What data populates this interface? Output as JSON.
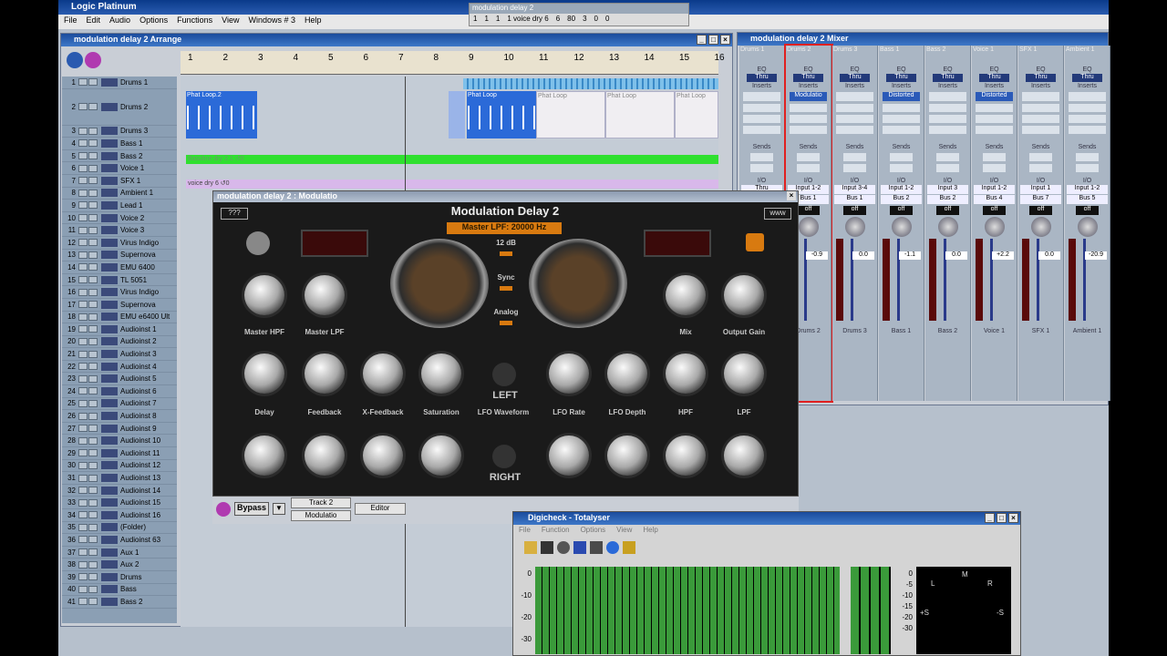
{
  "app": {
    "title": "Logic Platinum"
  },
  "menu": [
    "File",
    "Edit",
    "Audio",
    "Options",
    "Functions",
    "View",
    "Windows # 3",
    "Help"
  ],
  "transport": {
    "title": "modulation delay 2",
    "values": [
      "1",
      "1",
      "1",
      "1 voice dry 6",
      "6",
      "80",
      "3",
      "0",
      "0"
    ]
  },
  "arrange": {
    "title": "modulation delay 2 Arrange",
    "ruler": [
      "1",
      "2",
      "3",
      "4",
      "5",
      "6",
      "7",
      "8",
      "9",
      "10",
      "11",
      "12",
      "13",
      "14",
      "15",
      "16"
    ],
    "tracks": [
      {
        "n": "1",
        "name": "Drums 1"
      },
      {
        "n": "2",
        "name": "Drums 2"
      },
      {
        "n": "3",
        "name": "Drums 3"
      },
      {
        "n": "4",
        "name": "Bass 1"
      },
      {
        "n": "5",
        "name": "Bass 2"
      },
      {
        "n": "6",
        "name": "Voice 1"
      },
      {
        "n": "7",
        "name": "SFX 1"
      },
      {
        "n": "8",
        "name": "Ambient 1"
      },
      {
        "n": "9",
        "name": "Lead 1"
      },
      {
        "n": "10",
        "name": "Voice 2"
      },
      {
        "n": "11",
        "name": "Voice 3"
      },
      {
        "n": "12",
        "name": "Virus Indigo"
      },
      {
        "n": "13",
        "name": "Supernova"
      },
      {
        "n": "14",
        "name": "EMU 6400"
      },
      {
        "n": "15",
        "name": "TL 5051"
      },
      {
        "n": "16",
        "name": "Virus Indigo"
      },
      {
        "n": "17",
        "name": "Supernova"
      },
      {
        "n": "18",
        "name": "EMU e6400 Ult"
      },
      {
        "n": "19",
        "name": "Audioinst 1"
      },
      {
        "n": "20",
        "name": "Audioinst 2"
      },
      {
        "n": "21",
        "name": "Audioinst 3"
      },
      {
        "n": "22",
        "name": "Audioinst 4"
      },
      {
        "n": "23",
        "name": "Audioinst 5"
      },
      {
        "n": "24",
        "name": "Audioinst 6"
      },
      {
        "n": "25",
        "name": "Audioinst 7"
      },
      {
        "n": "26",
        "name": "Audioinst 8"
      },
      {
        "n": "27",
        "name": "Audioinst 9"
      },
      {
        "n": "28",
        "name": "Audioinst 10"
      },
      {
        "n": "29",
        "name": "Audioinst 11"
      },
      {
        "n": "30",
        "name": "Audioinst 12"
      },
      {
        "n": "31",
        "name": "Audioinst 13"
      },
      {
        "n": "32",
        "name": "Audioinst 14"
      },
      {
        "n": "33",
        "name": "Audioinst 15"
      },
      {
        "n": "34",
        "name": "Audioinst 16"
      },
      {
        "n": "35",
        "name": "(Folder)"
      },
      {
        "n": "36",
        "name": "Audioinst 63"
      },
      {
        "n": "37",
        "name": "Aux 1"
      },
      {
        "n": "38",
        "name": "Aux 2"
      },
      {
        "n": "39",
        "name": "Drums"
      },
      {
        "n": "40",
        "name": "Bass"
      },
      {
        "n": "41",
        "name": "Bass 2"
      }
    ],
    "regions": {
      "phat1": "Phat Loop.2",
      "phat2": "Phat Loop",
      "phat3": "Phat Loop",
      "phat4": "Phat Loop",
      "phat5": "Phat Loop",
      "bass": "Bassline dry 2.1 ↺0",
      "voice": "voice dry 6 ↺0"
    }
  },
  "mixer": {
    "title": "modulation delay 2 Mixer",
    "strips": [
      {
        "top": "Drums 1",
        "insert": "",
        "io": "Thru",
        "out": "Track 2",
        "vol": "",
        "bottom": ""
      },
      {
        "top": "Drums 2",
        "insert": "Modulatio",
        "io": "Input 1-2",
        "out": "Bus 1",
        "vol": "-0.9",
        "bottom": "Drums 2"
      },
      {
        "top": "Drums 3",
        "insert": "",
        "io": "Input 3-4",
        "out": "Bus 1",
        "vol": "0.0",
        "bottom": "Drums 3"
      },
      {
        "top": "Bass 1",
        "insert": "Distorted",
        "io": "Input 1-2",
        "out": "Bus 2",
        "vol": "-1.1",
        "bottom": "Bass 1"
      },
      {
        "top": "Bass 2",
        "insert": "",
        "io": "Input 3",
        "out": "Bus 2",
        "vol": "0.0",
        "bottom": "Bass 2"
      },
      {
        "top": "Voice 1",
        "insert": "Distorted",
        "io": "Input 1-2",
        "out": "Bus 4",
        "vol": "+2.2",
        "bottom": "Voice 1"
      },
      {
        "top": "SFX 1",
        "insert": "",
        "io": "Input 1",
        "out": "Bus 7",
        "vol": "0.0",
        "bottom": "SFX 1"
      },
      {
        "top": "Ambient 1",
        "insert": "",
        "io": "Input 1-2",
        "out": "Bus 5",
        "vol": "-20.9",
        "bottom": "Ambient 1"
      }
    ],
    "labels": {
      "eq": "EQ",
      "inserts": "Inserts",
      "sends": "Sends",
      "io": "I/O",
      "off": "off"
    }
  },
  "plugin": {
    "title": "modulation delay 2 : Modulatio",
    "name": "Modulation Delay 2",
    "lpf": "Master LPF: 20000 Hz",
    "help": "???",
    "www": "www",
    "sw1": "12 dB",
    "sw2": "Sync",
    "sw3": "Analog",
    "top_knobs": [
      "Master HPF",
      "Master LPF",
      "Mix",
      "Output Gain"
    ],
    "row_labels": [
      "Delay",
      "Feedback",
      "X-Feedback",
      "Saturation",
      "LFO Waveform",
      "LFO Rate",
      "LFO Depth",
      "HPF",
      "LPF"
    ],
    "left": "LEFT",
    "right": "RIGHT",
    "bypass": "Bypass",
    "track": "Track 2",
    "slot": "Modulatio",
    "editor": "Editor"
  },
  "digicheck": {
    "title": "Digicheck - Totalyser",
    "menu": [
      "File",
      "Function",
      "Options",
      "View",
      "Help"
    ],
    "scale": [
      "0",
      "-10",
      "-20",
      "-30"
    ],
    "scale2": [
      "0",
      "-5",
      "-10",
      "-15",
      "-20",
      "-30"
    ],
    "scope": {
      "l": "L",
      "m": "M",
      "r": "R",
      "ls": "+S",
      "rs": "-S"
    }
  }
}
